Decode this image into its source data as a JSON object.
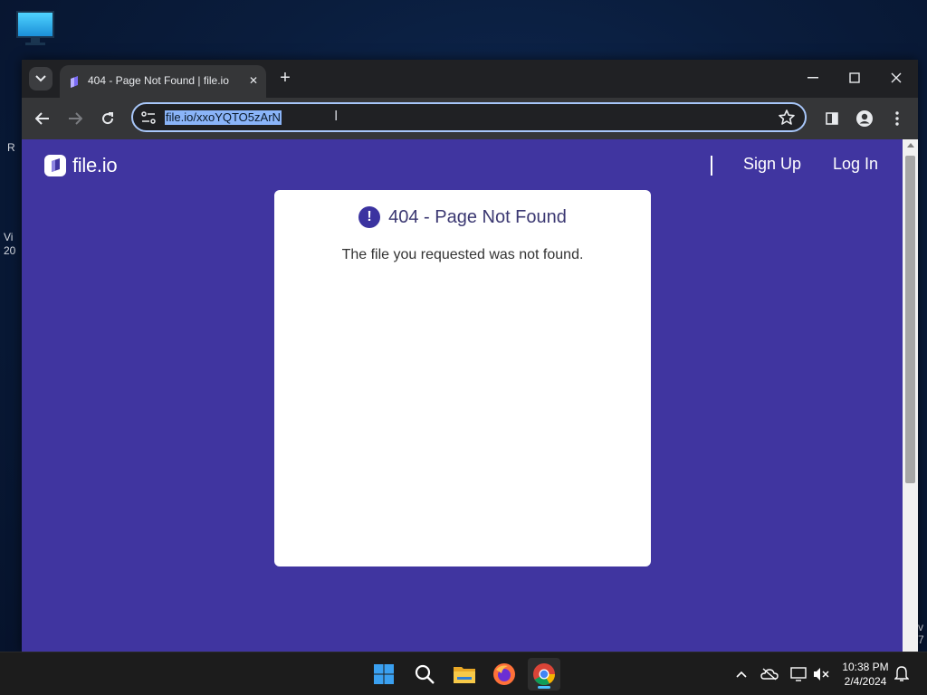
{
  "desktop": {
    "icons": [
      "monitor-icon"
    ],
    "edge_fragments": [
      "R",
      "Vi",
      "20",
      "v",
      "7"
    ]
  },
  "browser": {
    "tab": {
      "title": "404 - Page Not Found | file.io",
      "close_label": "✕"
    },
    "new_tab_label": "+",
    "window_controls": [
      "minimize-icon",
      "maximize-icon",
      "close-icon"
    ],
    "address_bar": {
      "url": "file.io/xxoYQTO5zArN"
    },
    "colors": {
      "accent": "#8ab4f8",
      "page_bg": "#4035a0",
      "frame": "#202124"
    }
  },
  "site": {
    "logo_text": "file.io",
    "nav": {
      "signup": "Sign Up",
      "login": "Log In"
    },
    "error": {
      "icon_glyph": "!",
      "title": "404 - Page Not Found",
      "message": "The file you requested was not found."
    }
  },
  "taskbar": {
    "apps": [
      "windows-start-icon",
      "search-icon",
      "file-explorer-icon",
      "firefox-icon",
      "chrome-icon"
    ],
    "active_app": "chrome-icon",
    "clock": {
      "time": "10:38 PM",
      "date": "2/4/2024"
    }
  }
}
